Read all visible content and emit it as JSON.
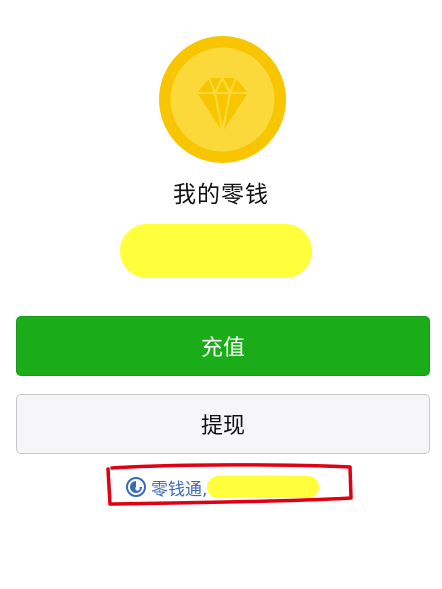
{
  "wallet": {
    "title": "我的零钱",
    "balance_masked": true
  },
  "actions": {
    "recharge_label": "充值",
    "withdraw_label": "提现"
  },
  "lingqiantong": {
    "label": "零钱通,",
    "icon": "lingqiantong-icon",
    "value_masked": true
  },
  "icons": {
    "coin": "diamond-coin-icon"
  },
  "colors": {
    "coin_outer": "#f7c600",
    "coin_inner": "#fbd93a",
    "recharge_bg": "#1aad19",
    "withdraw_bg": "#f6f6f8",
    "link": "#3c6bb5",
    "highlight_mask": "#ffff3c",
    "annotation_red": "#e00012"
  }
}
